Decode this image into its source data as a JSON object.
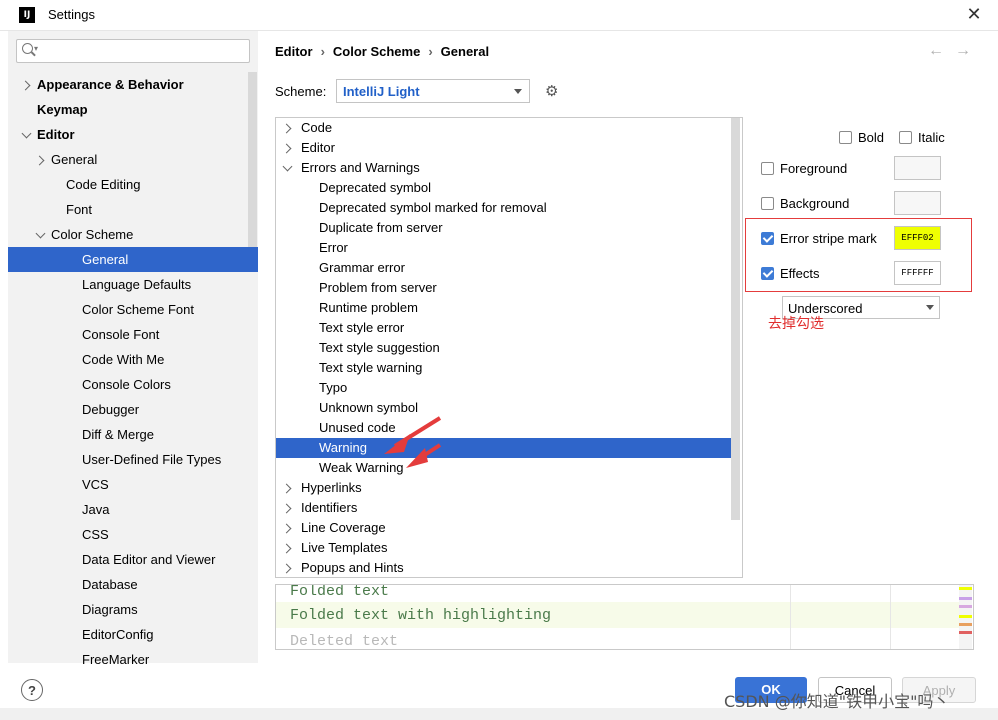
{
  "window": {
    "title": "Settings",
    "app_icon": "IJ"
  },
  "search": {
    "placeholder": ""
  },
  "sidebar": {
    "items": [
      {
        "label": "Appearance & Behavior",
        "bold": true
      },
      {
        "label": "Keymap",
        "bold": true
      },
      {
        "label": "Editor",
        "bold": true
      },
      {
        "label": "General"
      },
      {
        "label": "Code Editing"
      },
      {
        "label": "Font"
      },
      {
        "label": "Color Scheme"
      },
      {
        "label": "General",
        "selected": true
      },
      {
        "label": "Language Defaults"
      },
      {
        "label": "Color Scheme Font"
      },
      {
        "label": "Console Font"
      },
      {
        "label": "Code With Me"
      },
      {
        "label": "Console Colors"
      },
      {
        "label": "Debugger"
      },
      {
        "label": "Diff & Merge"
      },
      {
        "label": "User-Defined File Types"
      },
      {
        "label": "VCS"
      },
      {
        "label": "Java"
      },
      {
        "label": "CSS"
      },
      {
        "label": "Data Editor and Viewer"
      },
      {
        "label": "Database"
      },
      {
        "label": "Diagrams"
      },
      {
        "label": "EditorConfig"
      },
      {
        "label": "FreeMarker"
      }
    ]
  },
  "breadcrumb": [
    "Editor",
    "Color Scheme",
    "General"
  ],
  "scheme": {
    "label": "Scheme:",
    "value": "IntelliJ Light"
  },
  "tree": {
    "items": [
      {
        "label": "Code"
      },
      {
        "label": "Editor"
      },
      {
        "label": "Errors and Warnings"
      },
      {
        "label": "Deprecated symbol"
      },
      {
        "label": "Deprecated symbol marked for removal"
      },
      {
        "label": "Duplicate from server"
      },
      {
        "label": "Error"
      },
      {
        "label": "Grammar error"
      },
      {
        "label": "Problem from server"
      },
      {
        "label": "Runtime problem"
      },
      {
        "label": "Text style error"
      },
      {
        "label": "Text style suggestion"
      },
      {
        "label": "Text style warning"
      },
      {
        "label": "Typo"
      },
      {
        "label": "Unknown symbol"
      },
      {
        "label": "Unused code"
      },
      {
        "label": "Warning",
        "selected": true
      },
      {
        "label": "Weak Warning"
      },
      {
        "label": "Hyperlinks"
      },
      {
        "label": "Identifiers"
      },
      {
        "label": "Line Coverage"
      },
      {
        "label": "Live Templates"
      },
      {
        "label": "Popups and Hints"
      }
    ]
  },
  "options": {
    "bold": {
      "label": "Bold",
      "checked": false
    },
    "italic": {
      "label": "Italic",
      "checked": false
    },
    "foreground": {
      "label": "Foreground",
      "checked": false
    },
    "background": {
      "label": "Background",
      "checked": false
    },
    "error_stripe": {
      "label": "Error stripe mark",
      "checked": true,
      "color": "EFFF02",
      "hex": "#efff02"
    },
    "effects": {
      "label": "Effects",
      "checked": true,
      "color": "FFFFFF",
      "hex": "#ffffff",
      "type": "Underscored"
    }
  },
  "annotation": {
    "note": "去掉勾选",
    "accent": "#e02e2e"
  },
  "preview": {
    "lines": [
      {
        "text": "Folded text",
        "color": "#4a7a4a"
      },
      {
        "text": "Folded text with highlighting",
        "color": "#4a7a4a"
      },
      {
        "text": "Deleted text",
        "color": "#b8b8b8"
      }
    ]
  },
  "buttons": {
    "help": "?",
    "ok": "OK",
    "cancel": "Cancel",
    "apply": "Apply"
  },
  "watermark": "CSDN @你知道\"铁甲小宝\"吗丶",
  "colors": {
    "accent": "#2f65ca",
    "ok_button": "#3973d6"
  }
}
